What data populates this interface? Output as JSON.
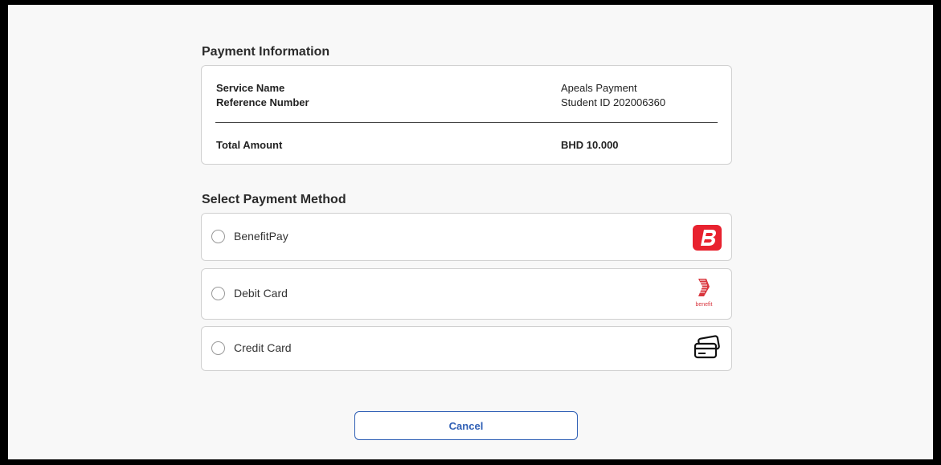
{
  "payment_info": {
    "title": "Payment Information",
    "service_name_label": "Service Name",
    "service_name_value": "Apeals Payment",
    "reference_number_label": "Reference Number",
    "reference_number_value": "Student ID 202006360",
    "total_amount_label": "Total Amount",
    "total_amount_value": "BHD 10.000"
  },
  "payment_methods": {
    "title": "Select Payment Method",
    "items": [
      {
        "label": "BenefitPay",
        "icon": "benefitpay-logo-icon",
        "color": "#e8222f"
      },
      {
        "label": "Debit Card",
        "icon": "benefit-logo-icon",
        "color": "#d9363e",
        "logo_text": "benefit"
      },
      {
        "label": "Credit Card",
        "icon": "credit-card-icon",
        "color": "#111111"
      }
    ]
  },
  "actions": {
    "cancel_label": "Cancel",
    "accent_color": "#2f5fb5"
  }
}
